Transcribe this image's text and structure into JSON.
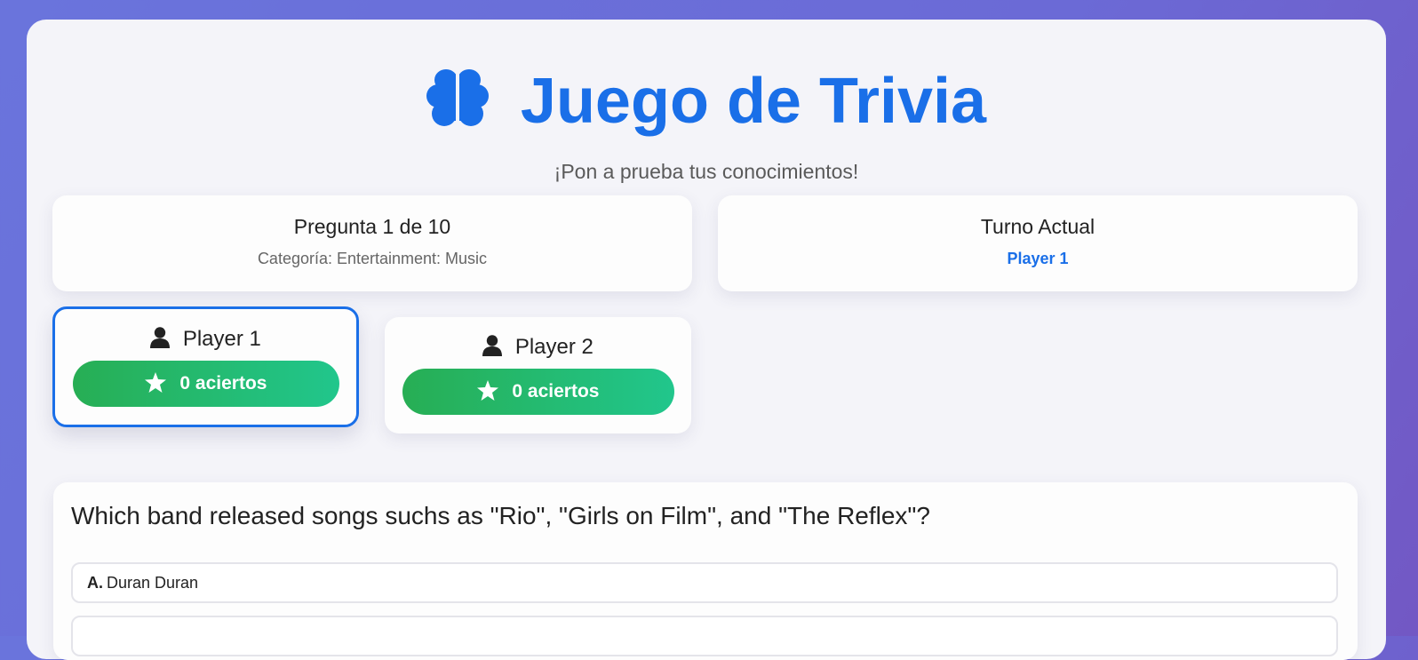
{
  "header": {
    "title": "Juego de Trivia",
    "subtitle": "¡Pon a prueba tus conocimientos!",
    "icon": "brain-icon"
  },
  "question_info": {
    "progress": "Pregunta 1 de 10",
    "category": "Categoría: Entertainment: Music"
  },
  "turn": {
    "label": "Turno Actual",
    "player": "Player 1"
  },
  "players": [
    {
      "name": "Player 1",
      "score": "0 aciertos",
      "active": true
    },
    {
      "name": "Player 2",
      "score": "0 aciertos",
      "active": false
    }
  ],
  "question": {
    "text": "Which band released songs suchs as \"Rio\", \"Girls on Film\", and \"The Reflex\"?",
    "options": [
      {
        "letter": "A.",
        "text": "Duran Duran"
      },
      {
        "letter": "",
        "text": ""
      }
    ]
  },
  "colors": {
    "accent": "#1a6fe8",
    "score_start": "#27ae54",
    "score_end": "#21c68c",
    "background": "#6a74dc"
  }
}
